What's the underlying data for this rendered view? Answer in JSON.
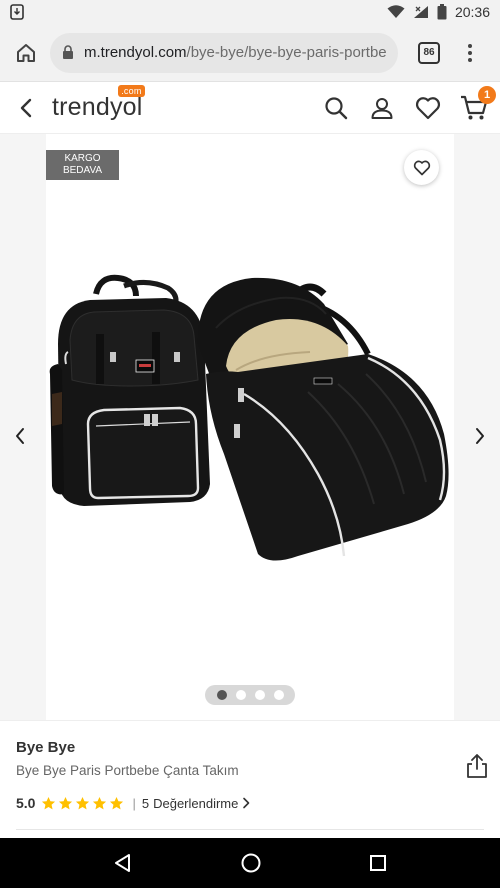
{
  "status_bar": {
    "time": "20:36"
  },
  "browser": {
    "url_domain": "m.trendyol.com",
    "url_path": "/bye-bye/bye-bye-paris-portbebe-",
    "tab_count": "86"
  },
  "header": {
    "logo_text": "trendyol",
    "logo_suffix": ".com",
    "cart_count": "1"
  },
  "gallery": {
    "badge_line1": "KARGO",
    "badge_line2": "BEDAVA",
    "image_count": 4,
    "active_image": 1
  },
  "product": {
    "brand": "Bye Bye",
    "name": "Bye Bye Paris Portbebe Çanta Takım",
    "rating": "5.0",
    "stars": 5,
    "review_count": "5",
    "review_label": "Değerlendirme"
  },
  "colors": {
    "accent": "#f27a1a",
    "star": "#ffc000",
    "badge_bg": "#6b6b6b"
  }
}
